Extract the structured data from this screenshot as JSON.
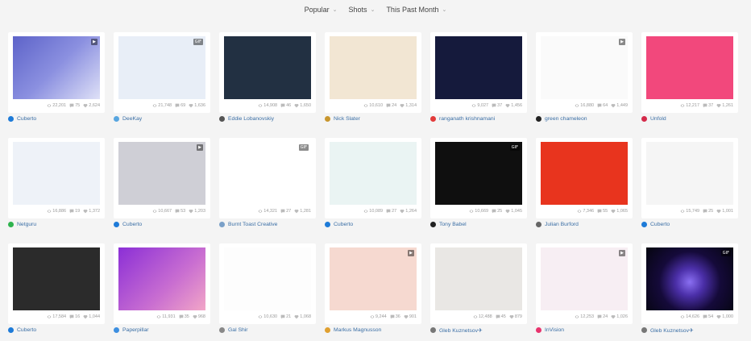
{
  "filters": [
    {
      "label": "Popular"
    },
    {
      "label": "Shots"
    },
    {
      "label": "This Past Month"
    }
  ],
  "shots": [
    {
      "author": "Cuberto",
      "views": "22,201",
      "comments": "75",
      "likes": "2,624",
      "badge": "video",
      "thumb": "t-blue",
      "avatar": "#1e7bd8"
    },
    {
      "author": "DeeKay",
      "views": "21,748",
      "comments": "69",
      "likes": "1,636",
      "badge": "gif",
      "thumb": "t-peach",
      "avatar": "#58a6e0"
    },
    {
      "author": "Eddie Lobanovskiy",
      "views": "14,908",
      "comments": "46",
      "likes": "1,650",
      "badge": "",
      "thumb": "t-dark",
      "avatar": "#555"
    },
    {
      "author": "Nick Slater",
      "views": "10,610",
      "comments": "24",
      "likes": "1,314",
      "badge": "",
      "thumb": "t-geo",
      "avatar": "#c8962e"
    },
    {
      "author": "ranganath krishnamani",
      "views": "9,027",
      "comments": "37",
      "likes": "1,456",
      "badge": "",
      "thumb": "t-night",
      "avatar": "#e23b3b"
    },
    {
      "author": "green chameleon",
      "views": "16,880",
      "comments": "64",
      "likes": "1,449",
      "badge": "video",
      "thumb": "t-white",
      "avatar": "#222"
    },
    {
      "author": "Unfold",
      "views": "12,217",
      "comments": "37",
      "likes": "1,261",
      "badge": "",
      "thumb": "t-pink",
      "avatar": "#d42a4a"
    },
    {
      "author": "Netguru",
      "views": "16,886",
      "comments": "19",
      "likes": "1,372",
      "badge": "",
      "thumb": "t-phoneblue",
      "avatar": "#2fb34e"
    },
    {
      "author": "Cuberto",
      "views": "10,667",
      "comments": "53",
      "likes": "1,203",
      "badge": "video",
      "thumb": "t-github",
      "avatar": "#1e7bd8"
    },
    {
      "author": "Burnt Toast Creative",
      "views": "14,321",
      "comments": "27",
      "likes": "1,281",
      "badge": "gif",
      "thumb": "t-bread",
      "avatar": "#7aa0c8"
    },
    {
      "author": "Cuberto",
      "views": "10,089",
      "comments": "27",
      "likes": "1,264",
      "badge": "",
      "thumb": "t-cyan",
      "avatar": "#1e7bd8"
    },
    {
      "author": "Tony Babel",
      "views": "10,669",
      "comments": "25",
      "likes": "1,045",
      "badge": "gif",
      "thumb": "t-black",
      "avatar": "#222"
    },
    {
      "author": "Julian Burford",
      "views": "7,346",
      "comments": "55",
      "likes": "1,065",
      "badge": "",
      "thumb": "t-redglass",
      "avatar": "#666"
    },
    {
      "author": "Cuberto",
      "views": "15,749",
      "comments": "25",
      "likes": "1,001",
      "badge": "",
      "thumb": "t-uiapp",
      "avatar": "#1e7bd8"
    },
    {
      "author": "Cuberto",
      "views": "17,584",
      "comments": "16",
      "likes": "1,044",
      "badge": "",
      "thumb": "t-dark2",
      "avatar": "#1e7bd8"
    },
    {
      "author": "Paperpillar",
      "views": "11,931",
      "comments": "35",
      "likes": "968",
      "badge": "",
      "thumb": "t-violet",
      "avatar": "#3d8fe0"
    },
    {
      "author": "Gal Shir",
      "views": "10,630",
      "comments": "21",
      "likes": "1,068",
      "badge": "",
      "thumb": "t-plain",
      "avatar": "#888"
    },
    {
      "author": "Markus Magnusson",
      "views": "9,244",
      "comments": "36",
      "likes": "901",
      "badge": "video",
      "thumb": "t-salmon",
      "avatar": "#e0a030"
    },
    {
      "author": "Gleb Kuznetsov✈",
      "views": "12,488",
      "comments": "45",
      "likes": "879",
      "badge": "",
      "thumb": "t-phone2",
      "avatar": "#777"
    },
    {
      "author": "InVision",
      "views": "12,253",
      "comments": "24",
      "likes": "1,026",
      "badge": "video",
      "thumb": "t-lilac",
      "avatar": "#e8336d"
    },
    {
      "author": "Gleb Kuznetsov✈",
      "views": "14,626",
      "comments": "54",
      "likes": "1,000",
      "badge": "gif",
      "thumb": "t-space",
      "avatar": "#777"
    }
  ],
  "badge_labels": {
    "gif": "GIF",
    "video": "▶"
  }
}
